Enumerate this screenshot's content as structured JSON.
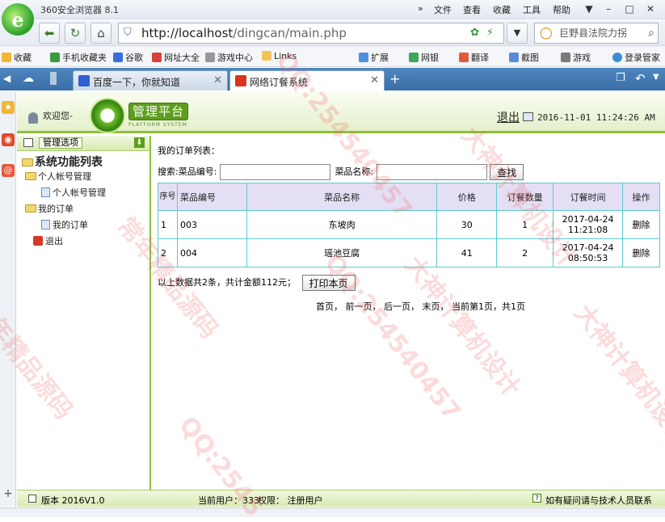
{
  "browser": {
    "title": "360安全浏览器 8.1",
    "menu": [
      "文件",
      "查看",
      "收藏",
      "工具",
      "帮助"
    ],
    "url_host": "http://localhost",
    "url_path": "/dingcan/main.php",
    "search_text": "巨野县法院力拐",
    "favorites": [
      "收藏",
      "手机收藏夹",
      "谷歌",
      "网址大全",
      "游戏中心",
      "Links",
      "扩展",
      "网银",
      "翻译",
      "截图",
      "游戏",
      "登录管家"
    ],
    "tabs": [
      {
        "label": "百度一下，你就知道",
        "active": false
      },
      {
        "label": "网络订餐系统",
        "active": true
      }
    ]
  },
  "header": {
    "welcome": "欢迎您-",
    "panel_title": "管理平台",
    "panel_subtitle": "PLATFORM SYSTEM",
    "logout": "退出",
    "datetime": "2016-11-01 11:24:26 AM"
  },
  "sidebar": {
    "header_label": "管理选项",
    "tree_title": "系统功能列表",
    "items": [
      {
        "label": "个人帐号管理",
        "level": 1,
        "type": "folder"
      },
      {
        "label": "个人帐号管理",
        "level": 2,
        "type": "doc"
      },
      {
        "label": "我的订单",
        "level": 1,
        "type": "folder"
      },
      {
        "label": "我的订单",
        "level": 2,
        "type": "doc"
      },
      {
        "label": "退出",
        "level": 1,
        "type": "exit"
      }
    ]
  },
  "main": {
    "caption": "我的订单列表：",
    "search": {
      "prefix": "搜索:",
      "code_label": "菜品编号:",
      "name_label": "菜品名称:",
      "button": "查找",
      "code_value": "",
      "name_value": ""
    },
    "table": {
      "headers": [
        "序号",
        "菜品编号",
        "菜品名称",
        "价格",
        "订餐数量",
        "订餐时间",
        "操作"
      ],
      "rows": [
        {
          "no": "1",
          "code": "003",
          "name": "东坡肉",
          "price": "30",
          "qty": "1",
          "date": "2017-04-24",
          "time": "11:21:08",
          "action": "删除"
        },
        {
          "no": "2",
          "code": "004",
          "name": "瑶池豆腐",
          "price": "41",
          "qty": "2",
          "date": "2017-04-24",
          "time": "08:50:53",
          "action": "删除"
        }
      ]
    },
    "summary": "以上数据共2条，共计金额112元；",
    "print_button": "打印本页",
    "pager": {
      "first": "首页",
      "prev": "前一页",
      "next": "后一页",
      "last": "末页",
      "current": "当前第1页，共1页"
    }
  },
  "footer": {
    "version": "版本 2016V1.0",
    "current_user": "当前用户：333",
    "permission": "权限：  注册用户",
    "help": "如有疑问请与技术人员联系"
  },
  "watermarks": [
    "QQ:254540457",
    "大神计算机设计",
    "常年精品源码",
    "QQ:254540457",
    "大神计算机设计",
    "常年精品源码",
    "QQ:2545",
    "大神计算机设计"
  ]
}
